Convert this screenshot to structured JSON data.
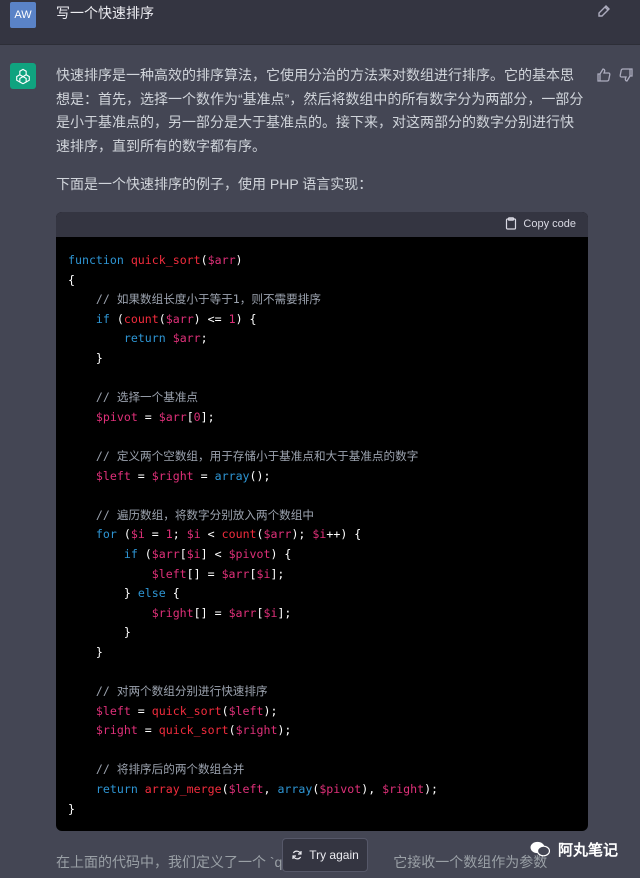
{
  "user": {
    "avatar_initials": "AW",
    "prompt": "写一个快速排序"
  },
  "response": {
    "paragraph1": "快速排序是一种高效的排序算法，它使用分治的方法来对数组进行排序。它的基本思想是：首先，选择一个数作为“基准点”，然后将数组中的所有数字分为两部分，一部分是小于基准点的，另一部分是大于基准点的。接下来，对这两部分的数字分别进行快速排序，直到所有的数字都有序。",
    "paragraph2": "下面是一个快速排序的例子，使用 PHP 语言实现：",
    "paragraph3": "在上面的代码中，我们定义了一个 `qui",
    "paragraph3_tail": "它接收一个数组作为参数"
  },
  "code": {
    "copy_label": "Copy code",
    "language": "php"
  },
  "actions": {
    "try_again_label": "Try again"
  },
  "watermark": {
    "text": "阿丸笔记"
  },
  "colors": {
    "page_bg": "#444654",
    "user_bg": "#343541",
    "bot_avatar": "#10a37f",
    "user_avatar": "#5a83c7",
    "code_bg": "#000000",
    "keyword": "#2e95d3",
    "function": "#f22c3d",
    "variable": "#df3079"
  }
}
